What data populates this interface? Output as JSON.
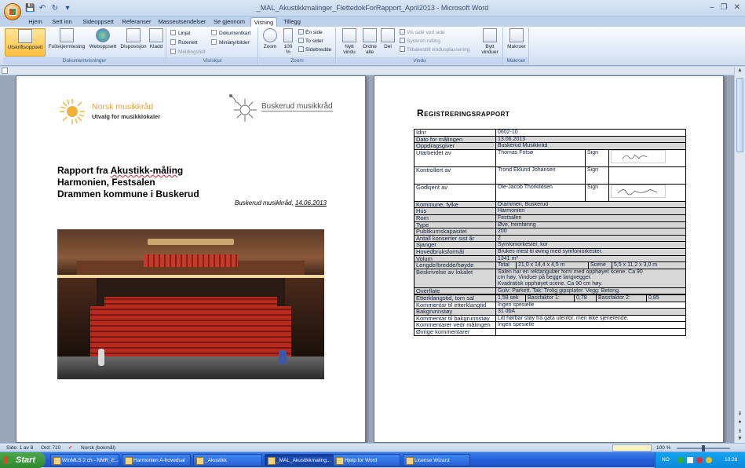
{
  "window": {
    "title": "_MAL_Akustikkmalinger_FlettedokForRapport_April2013 - Microsoft Word",
    "min_icon": "minimize-icon",
    "max_icon": "maximize-icon",
    "close_icon": "close-icon"
  },
  "qat": {
    "save": "💾",
    "undo": "↶",
    "redo": "↻",
    "more": "▾"
  },
  "tabs": [
    {
      "label": "Hjem"
    },
    {
      "label": "Sett inn"
    },
    {
      "label": "Sideoppsett"
    },
    {
      "label": "Referanser"
    },
    {
      "label": "Masseutsendelser"
    },
    {
      "label": "Se gjennom"
    },
    {
      "label": "Visning"
    },
    {
      "label": "Tillegg"
    }
  ],
  "ribbon": {
    "dokumentvisninger": {
      "label": "Dokumentvisninger",
      "buttons": [
        "Utskriftsoppsett",
        "Fullskjermlesing",
        "Weboppsett",
        "Disposisjon",
        "Kladd"
      ]
    },
    "vis_skjul": {
      "label": "Vis/skjul",
      "items": [
        "Linjal",
        "Rutenett",
        "Meldingsfelt",
        "Dokumentkart",
        "Miniatyrbilder"
      ]
    },
    "zoom": {
      "label": "Zoom",
      "zoom": "Zoom",
      "percent": "100 %",
      "en_side": "Én side",
      "to_sider": "To sider",
      "sidebredde": "Sidebredde"
    },
    "vindu": {
      "label": "Vindu",
      "nytt": "Nytt vindu",
      "ordne": "Ordne alle",
      "del": "Del",
      "vis_side": "Vis side ved side",
      "synkron": "Synkron rulling",
      "tilbakestill": "Tilbakestill vindusplassering",
      "bytt": "Bytt vinduer"
    },
    "makroer": {
      "label": "Makroer",
      "button": "Makroer"
    }
  },
  "page1": {
    "logo_left_name": "Norsk musikkråd",
    "logo_left_sub": "Utvalg for musikklokaler",
    "logo_right_name": "Buskerud musikkråd",
    "title_prefix": "Rapport fra ",
    "title_underlined": "Akustikk-måling",
    "title_line2": "Harmonien, Festsalen",
    "title_line3": "Drammen kommune i Buskerud",
    "byline_prefix": "Buskerud musikkråd, ",
    "byline_date": "14.06.2013",
    "photo_alt": "concert-hall-photo"
  },
  "page2": {
    "heading": "Registreringsrapport",
    "sign_label": "Sign",
    "rows": [
      {
        "k": "Idnr",
        "v": "0602-10",
        "gray": false
      },
      {
        "k": "Dato for målingen",
        "v": "13.06.2013",
        "gray": true
      },
      {
        "k": "Oppdragsgiver",
        "v": "Buskerud Musikkråd",
        "gray": true
      },
      {
        "k": "Utarbeidet av",
        "v": "Thomas Fritsø",
        "gray": false
      },
      {
        "k": "Kontrollert av",
        "v": "Trond Eklund Johansen",
        "gray": false
      },
      {
        "k": "Godkjent av",
        "v": "Ole-Jacob Thorkildsen",
        "gray": false
      },
      {
        "k": "Kommune, fylke",
        "v": "Drammen, Buskerud",
        "gray": true
      },
      {
        "k": "Hus",
        "v": "Harmonien",
        "gray": true
      },
      {
        "k": "Rom",
        "v": "Festsalen",
        "gray": true
      },
      {
        "k": "Type",
        "v": "Øve, fremføring",
        "gray": true
      },
      {
        "k": "Publikumskapasitet",
        "v": "200",
        "gray": true
      },
      {
        "k": "Antall konserter sist år",
        "v": "2",
        "gray": true
      },
      {
        "k": "Sjanger",
        "v": "Symfoniorkester, kor",
        "gray": true
      },
      {
        "k": "Hovedbruksformål",
        "v": "Brukes mest til øving med symfoniorkester.",
        "gray": true
      },
      {
        "k": "Volum",
        "v": "1341 m³",
        "gray": true
      }
    ],
    "lengde_label": "Lengde/bredde/høyde",
    "total_label": "Total",
    "total_value": "21,0 x 14,4 x 4,5 m",
    "scene_label": "Scene",
    "scene_value": "5,5 x 11,2 x 3,0 m",
    "beskrivelse_label": "Beskrivelse av lokalet",
    "beskrivelse_lines": [
      "Salen har en rektangulær form med opphøyet scene. Ca 90",
      "cm høy. Vinduer på begge langvegger.",
      "Kvadratisk opphøyet scene. Ca 90 cm høy."
    ],
    "overflate_label": "Overflate",
    "overflate_value": "Gulv: Parkett. Tak: Trolig gipsplater. Vegg: Betong.",
    "etterklang_label": "Etterklangstid, tom sal",
    "etterklang_value": "1,58 sek",
    "bass1_label": "Bassfaktor 1:",
    "bass1_value": "0,78",
    "bass2_label": "Bassfaktor 2:",
    "bass2_value": "0,85",
    "komm_etterklang_label": "Kommentar til etterklangtid",
    "komm_etterklang_value": "Ingen spesielle",
    "bakgrunn_label": "Bakgrunnstøy",
    "bakgrunn_value": "31 dbA",
    "komm_bakgrunn_label": "Kommentar til bakgrunnstøy",
    "komm_bakgrunn_value": "Litt hørbar støy fra gata utenfor, men ikke sjenerende.",
    "komm_maling_label": "Kommentarer vedr målingen",
    "komm_maling_value": "Ingen spesielle",
    "ovrige_label": "Øvrige kommentarer",
    "ovrige_value": ""
  },
  "status": {
    "side": "Side: 1 av 8",
    "ord": "Ord: 710",
    "lang": "Norsk (bokmål)",
    "zoom": "100 %"
  },
  "taskbar": {
    "start": "Start",
    "items": [
      "WinMLS 2 ch - NMR_E...",
      "Harmonien A-hovedsal",
      "_Akustikk",
      "_MAL_Akustikkmaling...",
      "Hjelp for Word",
      "License Wizard"
    ],
    "lang": "NO",
    "time": "10:28"
  }
}
